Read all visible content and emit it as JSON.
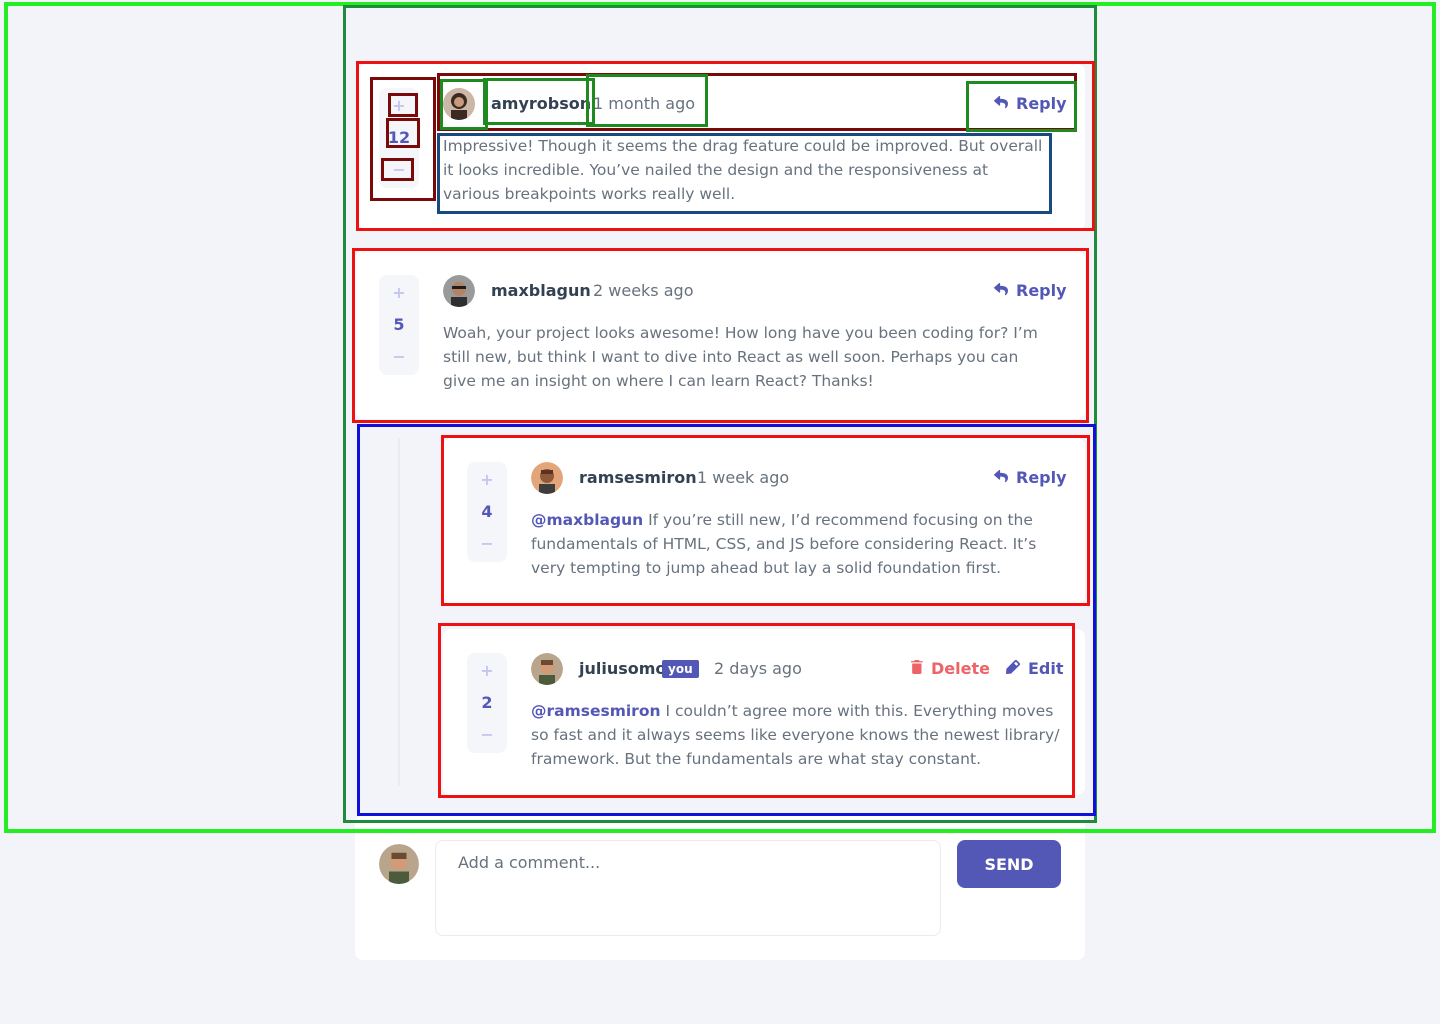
{
  "comments": [
    {
      "username": "amyrobson",
      "created": "1 month ago",
      "score": "12",
      "content": "Impressive! Though it seems the drag feature could be improved. But overall it looks incredible. You’ve nailed the design and the responsiveness at various breakpoints works really well.",
      "reply_label": "Reply",
      "avatar_color": "#3b2a22"
    },
    {
      "username": "maxblagun",
      "created": "2 weeks ago",
      "score": "5",
      "content": "Woah, your project looks awesome! How long have you been coding for? I’m still new, but think I want to dive into React as well soon. Perhaps you can give me an insight on where I can learn React? Thanks!",
      "reply_label": "Reply",
      "avatar_color": "#2f2f2f"
    }
  ],
  "replies": [
    {
      "username": "ramsesmiron",
      "created": "1 week ago",
      "score": "4",
      "replying_to": "@maxblagun",
      "content": " If you’re still new, I’d recommend focusing on the fundamentals of HTML, CSS, and JS before considering React. It’s very tempting to jump ahead but lay a solid foundation first.",
      "reply_label": "Reply",
      "avatar_color": "#b06a3a"
    },
    {
      "username": "juliusomo",
      "badge": "you",
      "created": "2 days ago",
      "score": "2",
      "replying_to": "@ramsesmiron",
      "content": " I couldn’t agree more with this. Everything moves so fast and it always seems like everyone knows the newest library/ framework. But the fundamentals are what stay constant.",
      "delete_label": "Delete",
      "edit_label": "Edit",
      "avatar_color": "#5a4030"
    }
  ],
  "new_comment": {
    "placeholder": "Add a comment...",
    "send_label": "SEND"
  },
  "vote": {
    "plus": "+",
    "minus": "−"
  },
  "colors": {
    "accent": "#5357b6",
    "delete": "#ed6368",
    "background": "#f3f4f9"
  },
  "icons": {
    "reply": "reply-icon",
    "delete": "trash-icon",
    "edit": "pencil-icon"
  }
}
